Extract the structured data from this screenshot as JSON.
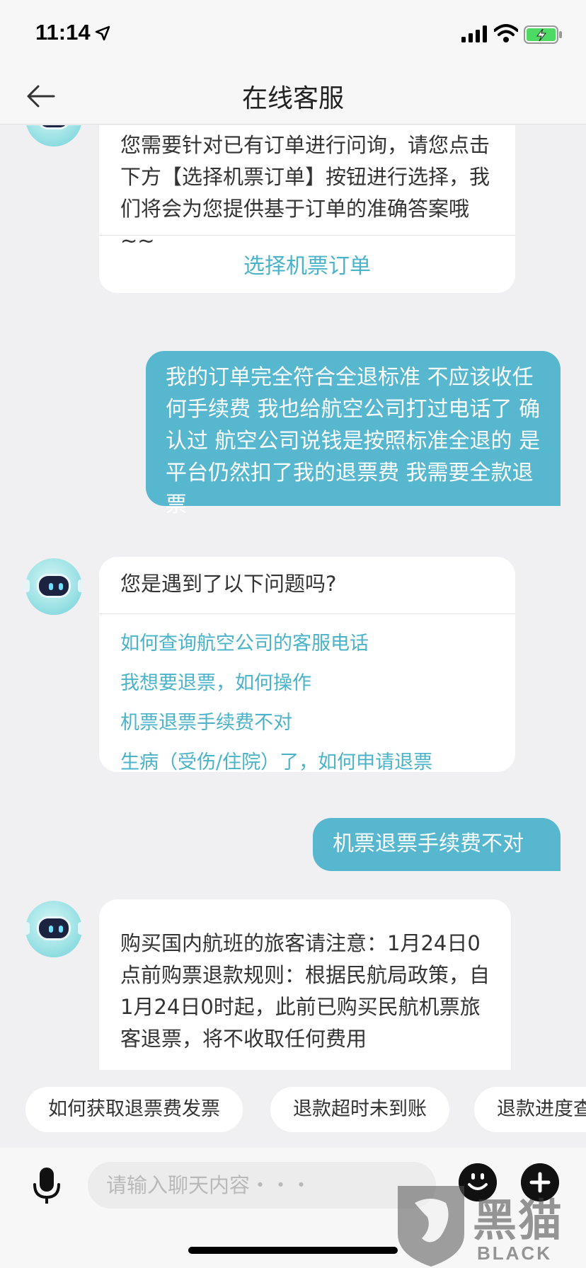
{
  "status_bar": {
    "time": "11:14"
  },
  "header": {
    "title": "在线客服"
  },
  "messages": {
    "bot1": {
      "text": "您需要针对已有订单进行问询，请您点击下方【选择机票订单】按钮进行选择，我们将会为您提供基于订单的准确答案哦 ~~",
      "action_label": "选择机票订单"
    },
    "user1": {
      "text": "我的订单完全符合全退标准 不应该收任何手续费 我也给航空公司打过电话了 确认过 航空公司说钱是按照标准全退的 是平台仍然扣了我的退票费 我需要全款退票"
    },
    "bot2": {
      "question": "您是遇到了以下问题吗?",
      "options": [
        "如何查询航空公司的客服电话",
        "我想要退票，如何操作",
        "机票退票手续费不对",
        "生病（受伤/住院）了，如何申请退票"
      ]
    },
    "user2": {
      "text": "机票退票手续费不对"
    },
    "bot3": {
      "text": "购买国内航班的旅客请注意：1月24日0点前购票退款规则：根据民航局政策，自1月24日0时起，此前已购买民航机票旅客退票，将不收取任何费用"
    }
  },
  "quick_replies": [
    "如何获取退票费发票",
    "退款超时未到账",
    "退款进度查询"
  ],
  "input": {
    "placeholder": "请输入聊天内容・・・"
  },
  "watermark": {
    "brand_cn": "黑猫",
    "brand_en": "BLACK CAT"
  },
  "colors": {
    "accent": "#56b7cf",
    "link": "#4bb3c9",
    "background": "#f0f0f2"
  }
}
